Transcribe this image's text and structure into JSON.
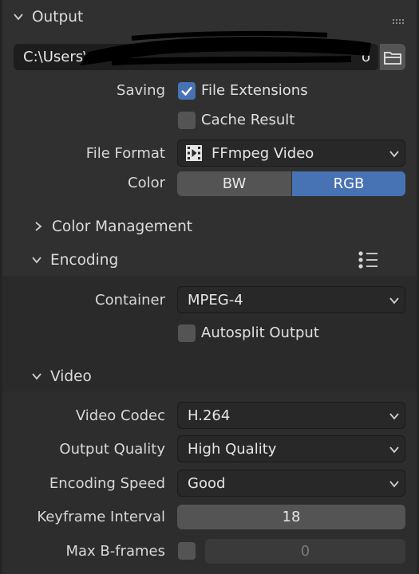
{
  "output": {
    "title": "Output",
    "path_value": "C:\\Users\\",
    "path_tail": "o",
    "saving_label": "Saving",
    "file_extensions_label": "File Extensions",
    "file_extensions_checked": true,
    "cache_result_label": "Cache Result",
    "cache_result_checked": false,
    "file_format_label": "File Format",
    "file_format_value": "FFmpeg Video",
    "color_label": "Color",
    "color_options": [
      "BW",
      "RGB"
    ],
    "color_selected": "RGB"
  },
  "color_management": {
    "title": "Color Management",
    "expanded": false
  },
  "encoding": {
    "title": "Encoding",
    "expanded": true,
    "container_label": "Container",
    "container_value": "MPEG-4",
    "autosplit_label": "Autosplit Output",
    "autosplit_checked": false
  },
  "video": {
    "title": "Video",
    "expanded": true,
    "codec_label": "Video Codec",
    "codec_value": "H.264",
    "quality_label": "Output Quality",
    "quality_value": "High Quality",
    "speed_label": "Encoding Speed",
    "speed_value": "Good",
    "keyframe_label": "Keyframe Interval",
    "keyframe_value": "18",
    "bframes_label": "Max B-frames",
    "bframes_checked": false,
    "bframes_value": "0"
  },
  "colors": {
    "accent": "#4772b3",
    "panel": "#303030",
    "field": "#1d1d1d"
  },
  "icons": [
    "chevron-down-icon",
    "chevron-right-icon",
    "folder-icon",
    "checkmark-icon",
    "film-icon",
    "list-icon",
    "drag-handle-icon"
  ]
}
